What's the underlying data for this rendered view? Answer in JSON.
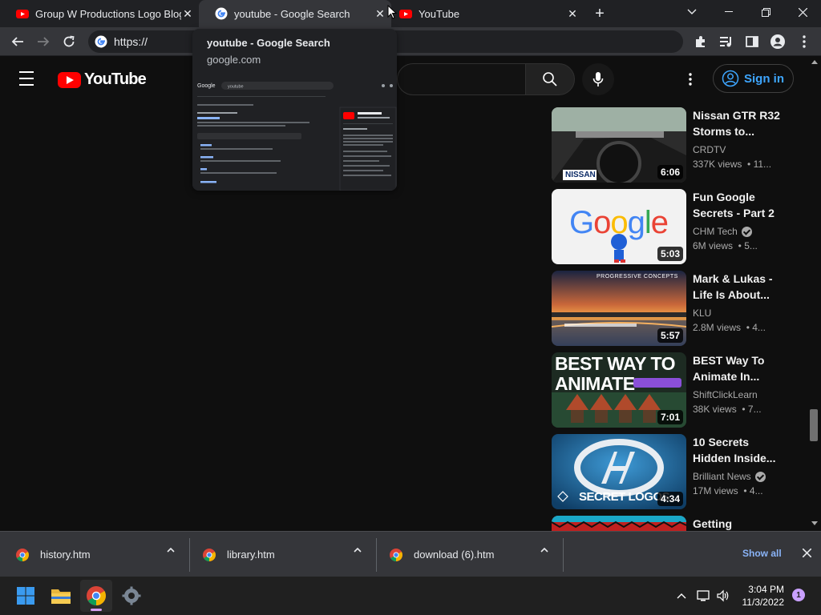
{
  "browser": {
    "tabs": [
      {
        "title": "Group W Productions Logo Blog",
        "favicon": "youtube-favicon",
        "close": "✕"
      },
      {
        "title": "youtube - Google Search",
        "favicon": "google-favicon",
        "close": "✕"
      },
      {
        "title": "YouTube",
        "favicon": "youtube-favicon",
        "close": "✕"
      }
    ],
    "new_tab": "+",
    "address": "https://",
    "hover_card": {
      "title": "youtube - Google Search",
      "domain": "google.com",
      "preview_query": "youtube"
    }
  },
  "youtube": {
    "logo_text": "YouTube",
    "sign_in": "Sign in",
    "recommendations": [
      {
        "title": "Nissan GTR R32 Storms to...",
        "channel": "CRDTV",
        "verified": false,
        "views": "337K views",
        "age": "11...",
        "duration": "6:06",
        "thumb_text": "NISSAN"
      },
      {
        "title": "Fun Google Secrets - Part 2",
        "channel": "CHM Tech",
        "verified": true,
        "views": "6M views",
        "age": "5...",
        "duration": "5:03",
        "thumb_text": "Google"
      },
      {
        "title": "Mark & Lukas - Life Is About...",
        "channel": "KLU",
        "verified": false,
        "views": "2.8M views",
        "age": "4...",
        "duration": "5:57",
        "thumb_text": "PROGRESSIVE CONCEPTS"
      },
      {
        "title": "BEST Way To Animate In...",
        "channel": "ShiftClickLearn",
        "verified": false,
        "views": "38K views",
        "age": "7...",
        "duration": "7:01",
        "thumb_text": "BEST WAY TO ANIMATE"
      },
      {
        "title": "10 Secrets Hidden Inside...",
        "channel": "Brilliant News",
        "verified": true,
        "views": "17M views",
        "age": "4...",
        "duration": "4:34",
        "thumb_text": "SECRET LOGOS"
      },
      {
        "title": "Getting",
        "channel": "",
        "verified": false,
        "views": "",
        "age": "",
        "duration": "",
        "thumb_text": ""
      }
    ]
  },
  "downloads": {
    "items": [
      {
        "name": "history.htm"
      },
      {
        "name": "library.htm"
      },
      {
        "name": "download (6).htm"
      }
    ],
    "show_all": "Show all"
  },
  "taskbar": {
    "time": "3:04 PM",
    "date": "11/3/2022",
    "notifications": "1"
  },
  "colors": {
    "youtube_red": "#ff0000",
    "link_blue": "#3ea6ff",
    "chrome_dark": "#202124",
    "chrome_toolbar": "#35363a"
  }
}
